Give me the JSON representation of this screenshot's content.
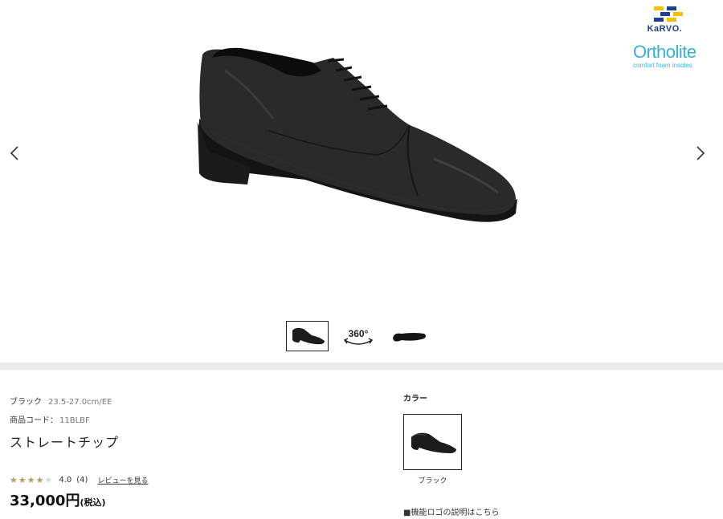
{
  "gallery": {
    "main_image": "black-straight-tip-oxford-shoe",
    "prev_icon": "chevron-left-icon",
    "next_icon": "chevron-right-icon",
    "thumbnails": [
      {
        "name": "side-view",
        "active": true
      },
      {
        "name": "360-view",
        "label": "360°",
        "active": false
      },
      {
        "name": "sole-view",
        "active": false
      }
    ]
  },
  "brand_logos": {
    "karvo": "KaRVO.",
    "ortholite": "Ortholite",
    "ortholite_sub": "comfort foam insoles"
  },
  "product": {
    "color": "ブラック",
    "size_range": "23.5-27.0cm/EE",
    "code_label": "商品コード：",
    "code": "11BLBF",
    "name": "ストレートチップ",
    "rating": {
      "stars_filled": 4,
      "stars_total": 5,
      "score": "4.0",
      "count": "(4)",
      "review_link": "レビューを見る"
    },
    "price": "33,000円",
    "tax_note": "(税込)"
  },
  "color_options": {
    "heading": "カラー",
    "items": [
      {
        "label": "ブラック",
        "selected": true
      }
    ]
  },
  "function_logo_link": "■機能ロゴの説明はこちら",
  "colors": {
    "star_filled": "#b89960",
    "star_empty": "#d8d8d8",
    "band": "#ececec",
    "karvo_blue": "#1f3f8f",
    "karvo_yellow": "#f2c200",
    "ortholite": "#3ab0d8"
  }
}
